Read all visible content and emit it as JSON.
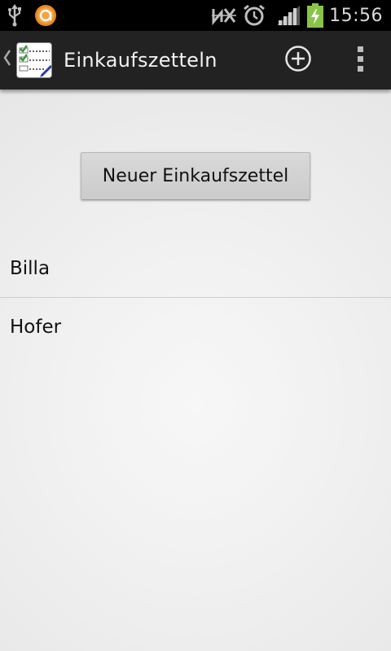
{
  "status_bar": {
    "time": "15:56",
    "icons": [
      "usb-icon",
      "app-notification-icon",
      "nfc-icon",
      "alarm-icon",
      "signal-icon",
      "battery-charging-icon"
    ]
  },
  "action_bar": {
    "title": "Einkaufszetteln",
    "up_icon": "chevron-left-icon",
    "app_icon": "shopping-list-app-icon",
    "actions": [
      "add-circle-icon",
      "overflow-menu-icon"
    ]
  },
  "content": {
    "new_button_label": "Neuer Einkaufszettel",
    "lists": [
      {
        "label": "Billa"
      },
      {
        "label": "Hofer"
      }
    ]
  },
  "colors": {
    "status_bar_bg": "#000000",
    "action_bar_bg": "#222222",
    "content_bg": "#f0f0f0",
    "battery_green": "#8bc34a",
    "notification_orange": "#e8891e"
  }
}
